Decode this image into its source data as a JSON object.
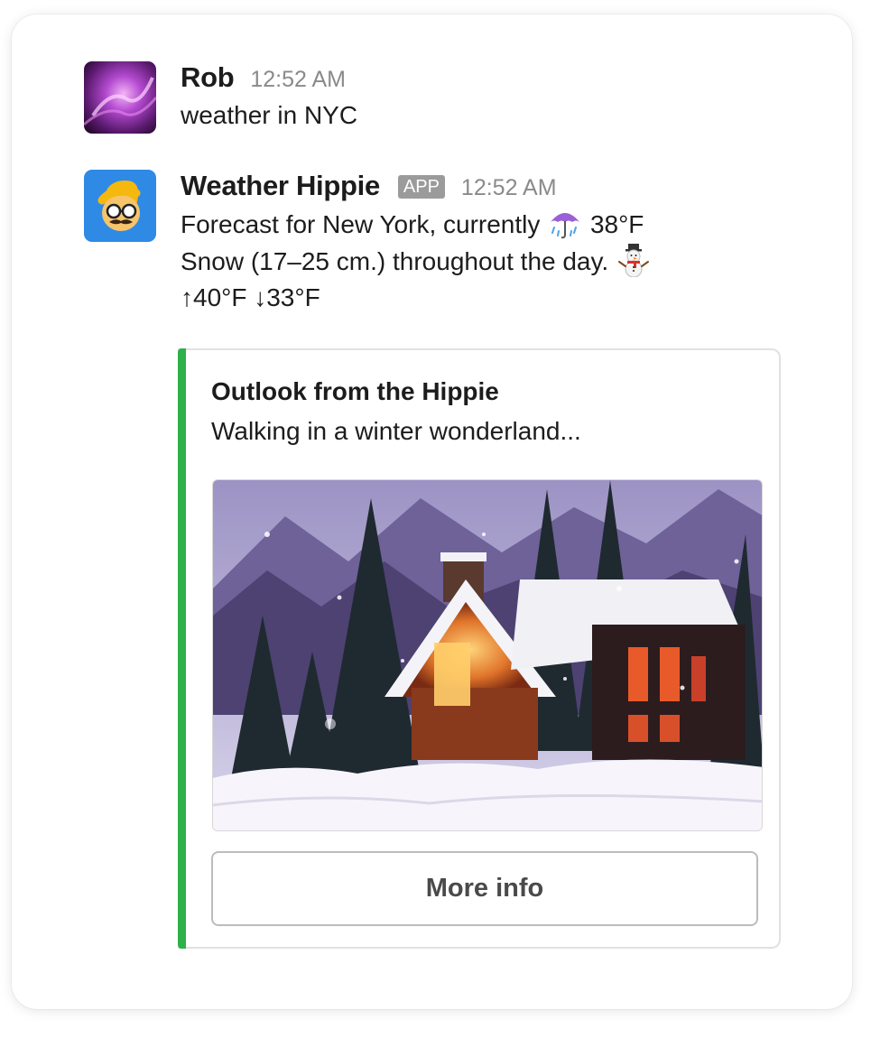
{
  "messages": [
    {
      "sender": "Rob",
      "time": "12:52 AM",
      "avatar_icon": "aurora-avatar-icon",
      "lines": [
        "weather in NYC"
      ]
    },
    {
      "sender": "Weather Hippie",
      "badge": "APP",
      "time": "12:52 AM",
      "avatar_icon": "hippie-face-avatar-icon",
      "line1": "Forecast for New York, currently",
      "line1_emoji": "umbrella-with-rain-icon",
      "line1_temp": "38°F",
      "line2": "Snow (17–25 cm.) throughout the day.",
      "line2_emoji": "snowman-icon",
      "line3": "↑40°F ↓33°F"
    }
  ],
  "attachment": {
    "accent_color": "#2eb04b",
    "title": "Outlook from the Hippie",
    "text": "Walking in a winter wonderland...",
    "image_icon": "snowy-cabin-photo",
    "button_label": "More info"
  }
}
